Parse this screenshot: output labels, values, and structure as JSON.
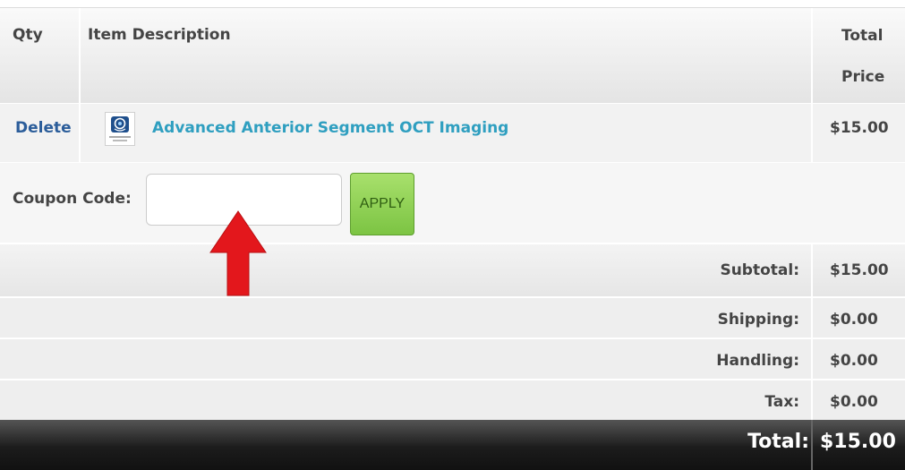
{
  "header": {
    "qty": "Qty",
    "description": "Item Description",
    "total_line1": "Total",
    "total_line2": "Price"
  },
  "item": {
    "delete_label": "Delete",
    "name": "Advanced Anterior Segment OCT Imaging",
    "price": "$15.00"
  },
  "coupon": {
    "label": "Coupon Code:",
    "value": "",
    "apply_label": "APPLY"
  },
  "totals": {
    "subtotal_label": "Subtotal:",
    "subtotal_value": "$15.00",
    "shipping_label": "Shipping:",
    "shipping_value": "$0.00",
    "handling_label": "Handling:",
    "handling_value": "$0.00",
    "tax_label": "Tax:",
    "tax_value": "$0.00",
    "total_label": "Total:",
    "total_value": "$15.00"
  },
  "colors": {
    "link_blue": "#2b5d9a",
    "item_link": "#2f9fc0",
    "apply_green": "#8fd35a",
    "arrow_red": "#e3171c"
  },
  "icons": {
    "product_thumbnail": "product-thumbnail-icon",
    "annotation": "red-arrow-icon"
  }
}
